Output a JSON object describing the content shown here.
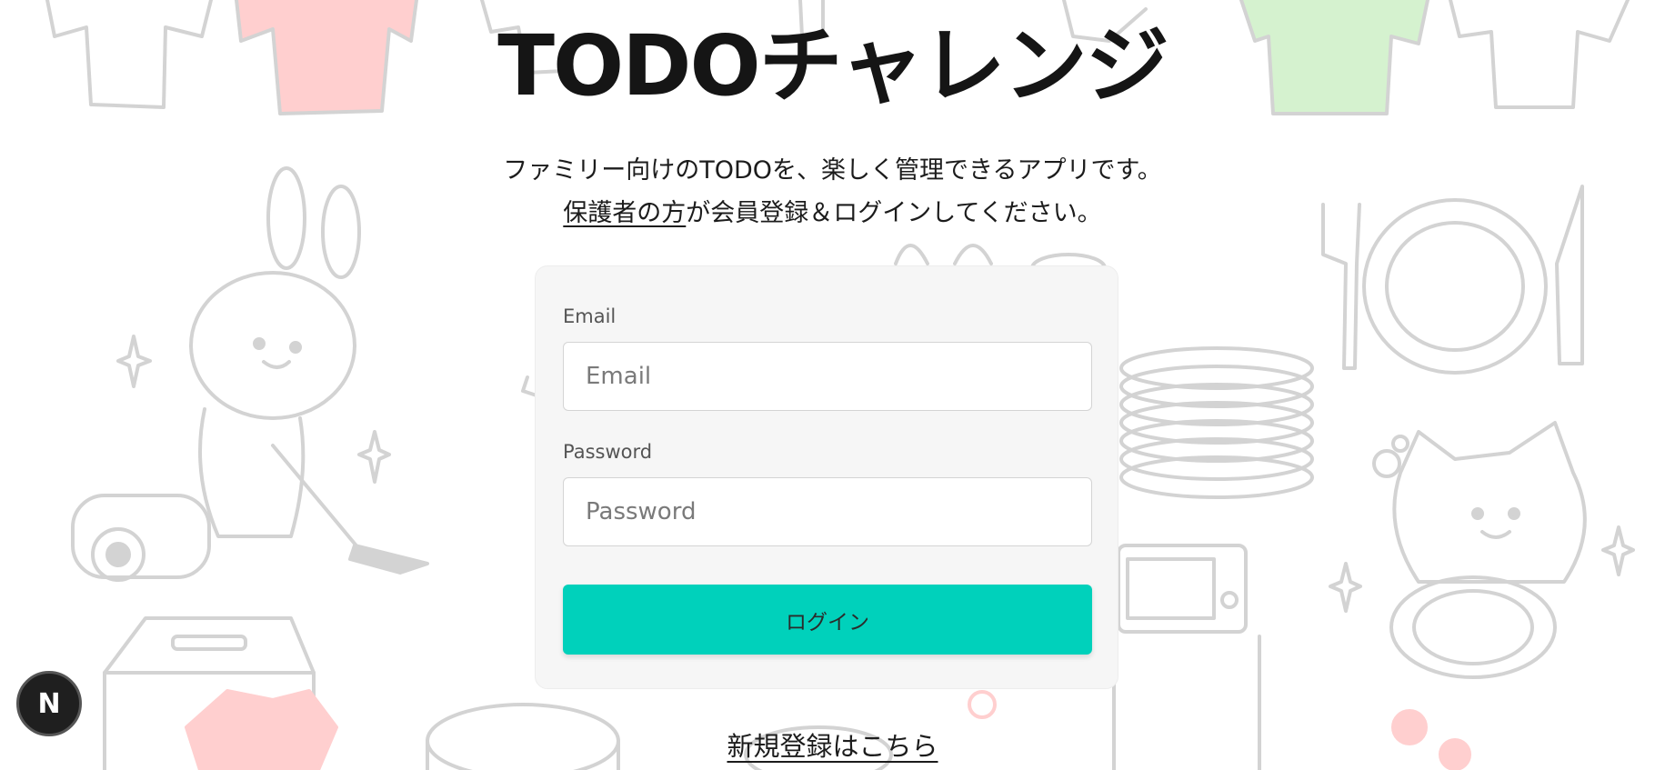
{
  "page": {
    "title": "TODOチャレンジ",
    "subtitle_line1": "ファミリー向けのTODOを、楽しく管理できるアプリです。",
    "subtitle_link": "保護者の方",
    "subtitle_line2_rest": "が会員登録＆ログインしてください。"
  },
  "form": {
    "email_label": "Email",
    "email_placeholder": "Email",
    "email_value": "",
    "password_label": "Password",
    "password_placeholder": "Password",
    "password_value": "",
    "login_label": "ログイン"
  },
  "register_link": "新規登録はこちら",
  "dev_badge": {
    "letter": "N"
  },
  "colors": {
    "accent": "#00d1bb",
    "card_bg": "#f6f6f6",
    "illustration_stroke": "#d3d3d3",
    "shirt_red": "#ffcfcf",
    "shirt_green": "#d5f2cf"
  },
  "background": {
    "icons": [
      "tshirt-icon",
      "rabbit-vacuum-icon",
      "sparkle-icon",
      "washing-machine-icon",
      "plate-stack-icon",
      "fork-plate-knife-icon",
      "microwave-icon",
      "cat-washing-dishes-icon",
      "rice-cooker-icon",
      "flower-icon"
    ]
  }
}
